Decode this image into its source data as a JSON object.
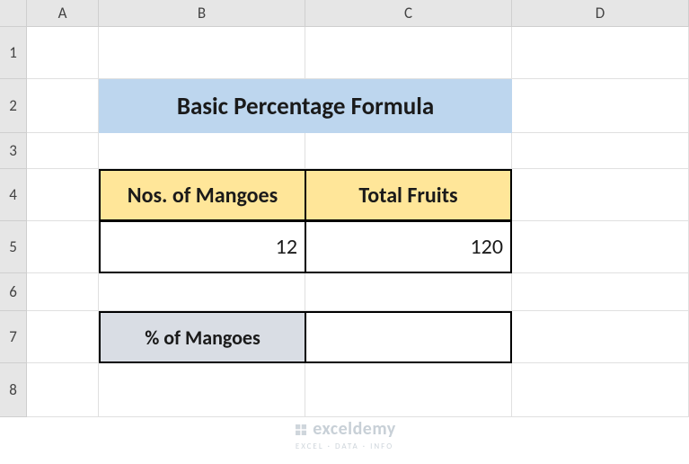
{
  "columns": [
    "A",
    "B",
    "C",
    "D"
  ],
  "rows": [
    "1",
    "2",
    "3",
    "4",
    "5",
    "6",
    "7",
    "8"
  ],
  "title": "Basic Percentage Formula",
  "table": {
    "headers": {
      "b": "Nos. of Mangoes",
      "c": "Total Fruits"
    },
    "values": {
      "b": "12",
      "c": "120"
    }
  },
  "pct": {
    "label": "% of Mangoes",
    "value": ""
  },
  "watermark": {
    "title": "exceldemy",
    "sub": "EXCEL · DATA · INFO"
  },
  "chart_data": {
    "type": "table",
    "title": "Basic Percentage Formula",
    "columns": [
      "Nos. of Mangoes",
      "Total Fruits"
    ],
    "rows": [
      [
        12,
        120
      ]
    ],
    "derived": {
      "label": "% of Mangoes",
      "value": null
    }
  }
}
